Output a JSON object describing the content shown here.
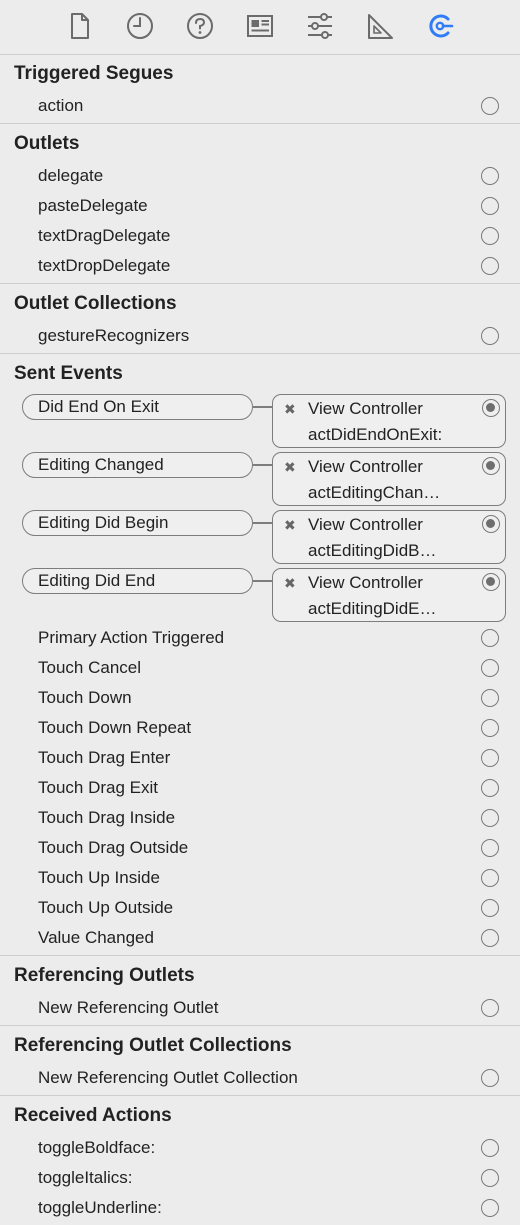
{
  "toolbar": {
    "icons": [
      "file-icon",
      "history-clock-icon",
      "help-icon",
      "identity-card-icon",
      "attributes-sliders-icon",
      "size-ruler-icon",
      "connections-icon"
    ],
    "active_color": "#2f7cf6",
    "inactive_color": "#6b6b6b"
  },
  "triggered_segues": {
    "title": "Triggered Segues",
    "items": [
      "action"
    ]
  },
  "outlets": {
    "title": "Outlets",
    "items": [
      "delegate",
      "pasteDelegate",
      "textDragDelegate",
      "textDropDelegate"
    ]
  },
  "outlet_collections": {
    "title": "Outlet Collections",
    "items": [
      "gestureRecognizers"
    ]
  },
  "sent_events": {
    "title": "Sent Events",
    "connected": [
      {
        "event": "Did End On Exit",
        "target": "View Controller",
        "action": "actDidEndOnExit:",
        "remove": "✖"
      },
      {
        "event": "Editing Changed",
        "target": "View Controller",
        "action": "actEditingChan…",
        "remove": "✖"
      },
      {
        "event": "Editing Did Begin",
        "target": "View Controller",
        "action": "actEditingDidB…",
        "remove": "✖"
      },
      {
        "event": "Editing Did End",
        "target": "View Controller",
        "action": "actEditingDidE…",
        "remove": "✖"
      }
    ],
    "items": [
      "Primary Action Triggered",
      "Touch Cancel",
      "Touch Down",
      "Touch Down Repeat",
      "Touch Drag Enter",
      "Touch Drag Exit",
      "Touch Drag Inside",
      "Touch Drag Outside",
      "Touch Up Inside",
      "Touch Up Outside",
      "Value Changed"
    ]
  },
  "referencing_outlets": {
    "title": "Referencing Outlets",
    "items": [
      "New Referencing Outlet"
    ]
  },
  "referencing_outlet_collections": {
    "title": "Referencing Outlet Collections",
    "items": [
      "New Referencing Outlet Collection"
    ]
  },
  "received_actions": {
    "title": "Received Actions",
    "items": [
      "toggleBoldface:",
      "toggleItalics:",
      "toggleUnderline:"
    ]
  }
}
